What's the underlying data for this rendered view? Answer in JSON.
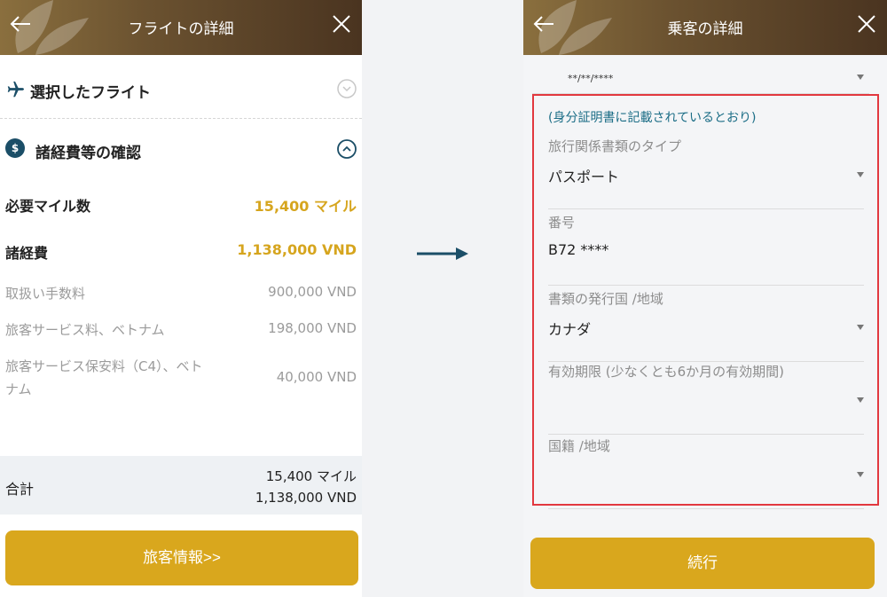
{
  "left": {
    "header": {
      "title": "フライトの詳細"
    },
    "selected_flight": {
      "label": "選択したフライト"
    },
    "fees_section": {
      "icon_text": "$",
      "label": "諸経費等の確認"
    },
    "required_miles": {
      "label": "必要マイル数",
      "value": "15,400 マイル"
    },
    "fees": {
      "label": "諸経費",
      "value": "1,138,000 VND"
    },
    "breakdown": [
      {
        "label": "取扱い手数料",
        "value": "900,000 VND"
      },
      {
        "label": "旅客サービス料、ベトナム",
        "value": "198,000 VND"
      },
      {
        "label": "旅客サービス保安料（C4）、ベト",
        "label2": "ナム",
        "value": "40,000 VND"
      }
    ],
    "total": {
      "label": "合計",
      "miles": "15,400 マイル",
      "amount": "1,138,000 VND"
    },
    "button": {
      "label": "旅客情報>>"
    }
  },
  "right": {
    "header": {
      "title": "乗客の詳細"
    },
    "dob_value": "**/**/****",
    "note": "(身分証明書に記載されているとおり)",
    "fields": [
      {
        "label": "旅行関係書類のタイプ",
        "value": "パスポート",
        "dropdown": true
      },
      {
        "label": "番号",
        "value": "B72  ****",
        "dropdown": false
      },
      {
        "label": "書類の発行国 /地域",
        "value": "カナダ",
        "dropdown": true
      },
      {
        "label": "有効期限 (少なくとも6か月の有効期間)",
        "value": "",
        "dropdown": true
      },
      {
        "label": "国籍 /地域",
        "value": "",
        "dropdown": true
      }
    ],
    "button": {
      "label": "続行"
    }
  },
  "colors": {
    "gold": "#d9a71d",
    "header_brown": "#5a4028",
    "teal": "#1b4e67",
    "highlight_red": "#e2383f"
  }
}
